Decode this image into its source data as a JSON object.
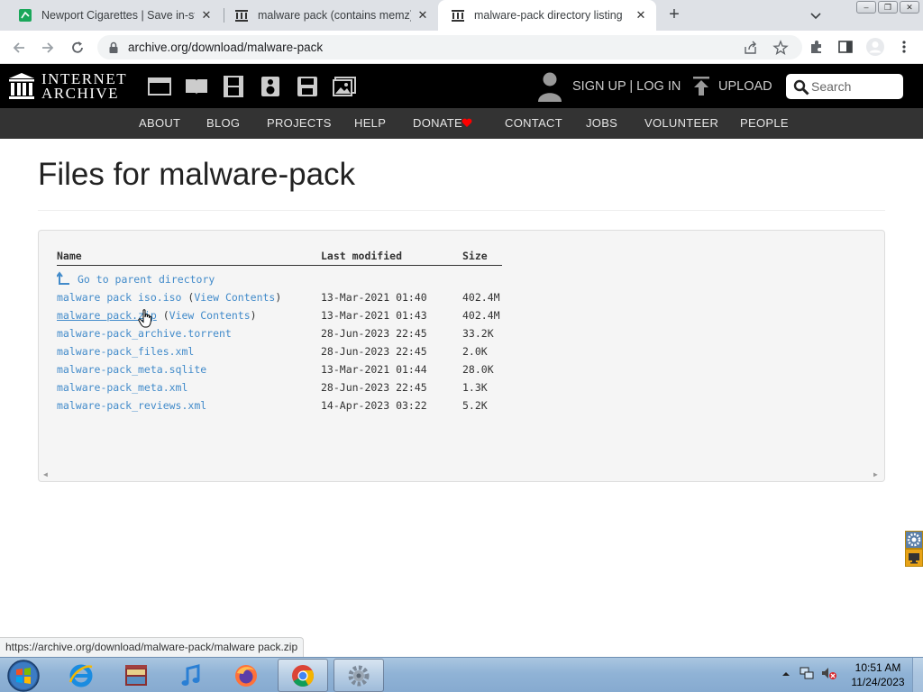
{
  "browser": {
    "tabs": [
      {
        "title": "Newport Cigarettes | Save in-sto",
        "favicon": "newport-favicon",
        "active": false
      },
      {
        "title": "malware pack (contains memz) :",
        "favicon": "internet-archive-favicon",
        "active": false
      },
      {
        "title": "malware-pack directory listing",
        "favicon": "internet-archive-favicon",
        "active": true
      }
    ],
    "url": "archive.org/download/malware-pack"
  },
  "ia_header": {
    "logo_line1": "INTERNET",
    "logo_line2": "ARCHIVE",
    "signup_label": "SIGN UP | LOG IN",
    "upload_label": "UPLOAD",
    "search_placeholder": "Search",
    "media_icons": [
      "web-icon",
      "texts-icon",
      "video-icon",
      "audio-icon",
      "software-icon",
      "images-icon"
    ]
  },
  "ia_nav": {
    "items": [
      "ABOUT",
      "BLOG",
      "PROJECTS",
      "HELP",
      "DONATE",
      "CONTACT",
      "JOBS",
      "VOLUNTEER",
      "PEOPLE"
    ],
    "donate_heart_color": "#ff0000"
  },
  "page": {
    "title": "Files for malware-pack"
  },
  "listing": {
    "headers": {
      "name": "Name",
      "modified": "Last modified",
      "size": "Size"
    },
    "parent": "Go to parent directory",
    "files": [
      {
        "name": "malware pack iso.iso",
        "view": "View Contents",
        "modified": "13-Mar-2021 01:40",
        "size": "402.4M"
      },
      {
        "name": "malware pack.zip",
        "view": "View Contents",
        "modified": "13-Mar-2021 01:43",
        "size": "402.4M"
      },
      {
        "name": "malware-pack_archive.torrent",
        "view": "",
        "modified": "28-Jun-2023 22:45",
        "size": "33.2K"
      },
      {
        "name": "malware-pack_files.xml",
        "view": "",
        "modified": "28-Jun-2023 22:45",
        "size": "2.0K"
      },
      {
        "name": "malware-pack_meta.sqlite",
        "view": "",
        "modified": "13-Mar-2021 01:44",
        "size": "28.0K"
      },
      {
        "name": "malware-pack_meta.xml",
        "view": "",
        "modified": "28-Jun-2023 22:45",
        "size": "1.3K"
      },
      {
        "name": "malware-pack_reviews.xml",
        "view": "",
        "modified": "14-Apr-2023 03:22",
        "size": "5.2K"
      }
    ]
  },
  "status_url": "https://archive.org/download/malware-pack/malware pack.zip",
  "taskbar": {
    "apps": [
      "internet-explorer-icon",
      "media-center-icon",
      "itunes-icon",
      "firefox-icon",
      "chrome-icon",
      "gear-app-icon"
    ],
    "time": "10:51 AM",
    "date": "11/24/2023"
  },
  "colors": {
    "link": "#428bca",
    "ia_header_bg": "#000000",
    "ia_nav_bg": "#333333"
  }
}
